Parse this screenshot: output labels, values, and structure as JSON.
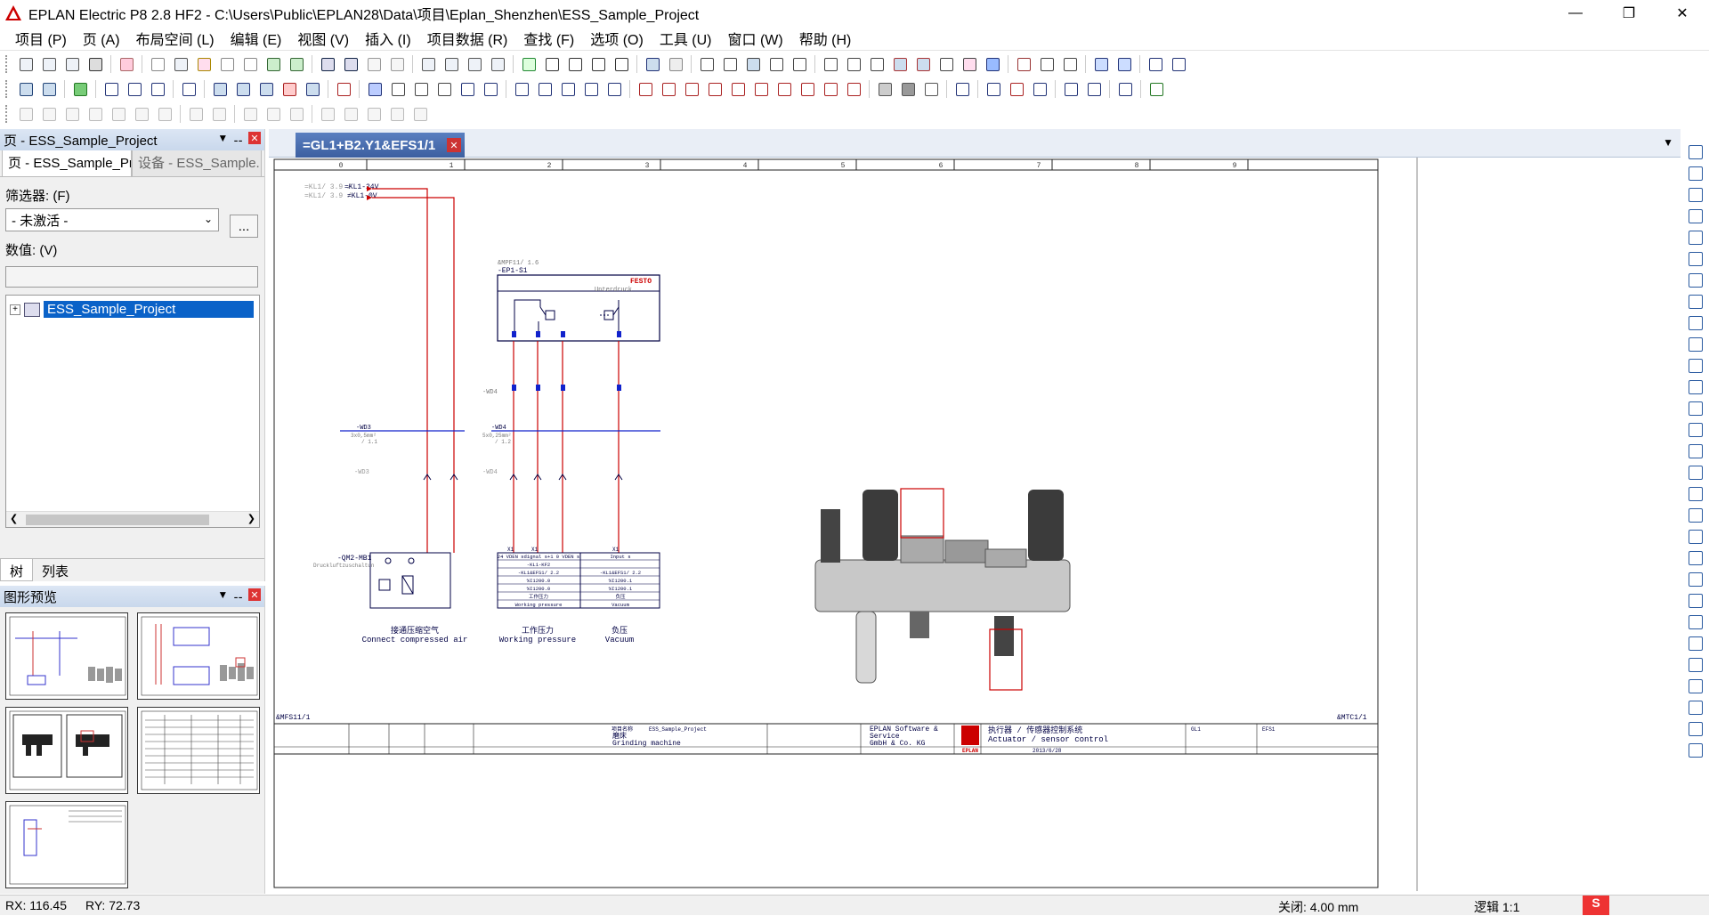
{
  "app": {
    "title": "EPLAN Electric P8 2.8 HF2 - C:\\Users\\Public\\EPLAN28\\Data\\项目\\Eplan_Shenzhen\\ESS_Sample_Project"
  },
  "menu": [
    "项目 (P)",
    "页 (A)",
    "布局空间 (L)",
    "编辑 (E)",
    "视图 (V)",
    "插入 (I)",
    "项目数据 (R)",
    "查找 (F)",
    "选项 (O)",
    "工具 (U)",
    "窗口 (W)",
    "帮助 (H)"
  ],
  "left_panel": {
    "header": "页 - ESS_Sample_Project",
    "tabs": [
      "页 - ESS_Sample_Pr...",
      "设备 - ESS_Sample..."
    ],
    "filter_label": "筛选器: (F)",
    "filter_value": "- 未激活 -",
    "filter_more": "...",
    "value_label": "数值: (V)",
    "tree_item": "ESS_Sample_Project",
    "bottom_tabs": [
      "树",
      "列表"
    ]
  },
  "preview_panel": {
    "header": "图形预览"
  },
  "document": {
    "tab": "=GL1+B2.Y1&EFS1/1",
    "ruler": [
      "0",
      "1",
      "2",
      "3",
      "4",
      "5",
      "6",
      "7",
      "8",
      "9"
    ],
    "left_ref": "&MFS11/1",
    "right_ref": "&MTC1/1",
    "wire_labels": [
      "=KL1-24V",
      "=KL1-0V"
    ],
    "wire_refs": [
      "=KL1/ 3.9 /",
      "=KL1/ 3.9 /"
    ],
    "ep_ref": "&MPF11/ 1.6",
    "ep_tag": "-EP1-S1",
    "festo": "FESTO",
    "ep_sub": "Unterdruck",
    "wd3": "-WD3",
    "wd3_sub": "3x0,5mm²",
    "wd3_sub2": "/ 1.1",
    "wd4a": "-WD4",
    "wd4b": "-WD4",
    "wd4b_sub": "5x0,25mm²",
    "wd4b_sub2": "/ 1.2",
    "wd3b": "-WD3",
    "wd4c": "-WD4",
    "qm_tag": "-QM2-MB1",
    "qm_sub": "Druckluftzuschaltun",
    "x_labels": [
      "X1",
      "X1",
      "X1"
    ],
    "captions": [
      {
        "cn": "接通压缩空气",
        "en": "Connect compressed air"
      },
      {
        "cn": "工作压力",
        "en": "Working pressure"
      },
      {
        "cn": "负压",
        "en": "Vacuum"
      }
    ],
    "table": {
      "left": [
        "24 VDEN sdignal s+1 0 VDEN s",
        "-KL1-KF2",
        "-KL1&EFS1/ 2.2",
        "%I1200.0",
        "%I1200.0",
        "工作压力",
        "Working pressure"
      ],
      "right": [
        "Input s",
        "",
        "-KL1&EFS1/ 2.2",
        "%I1200.1",
        "%I1200.1",
        "负压",
        "Vacuum"
      ]
    },
    "title_block": {
      "project_label": "项目名称",
      "project": "ESS_Sample_Project",
      "machine_cn": "磨床",
      "machine_en": "Grinding machine",
      "company1": "EPLAN Software &",
      "company2": "Service",
      "company3": "GmbH & Co. KG",
      "logo": "EPLAN",
      "desc_cn": "执行器 / 传感器控制系统",
      "desc_en": "Actuator / sensor control",
      "code1": "GL1",
      "code2": "EFS1",
      "date": "2013/6/28"
    }
  },
  "status": {
    "rx": "RX: 116.45",
    "ry": "RY: 72.73",
    "snap": "关闭: 4.00 mm",
    "scale": "逻辑 1:1"
  }
}
